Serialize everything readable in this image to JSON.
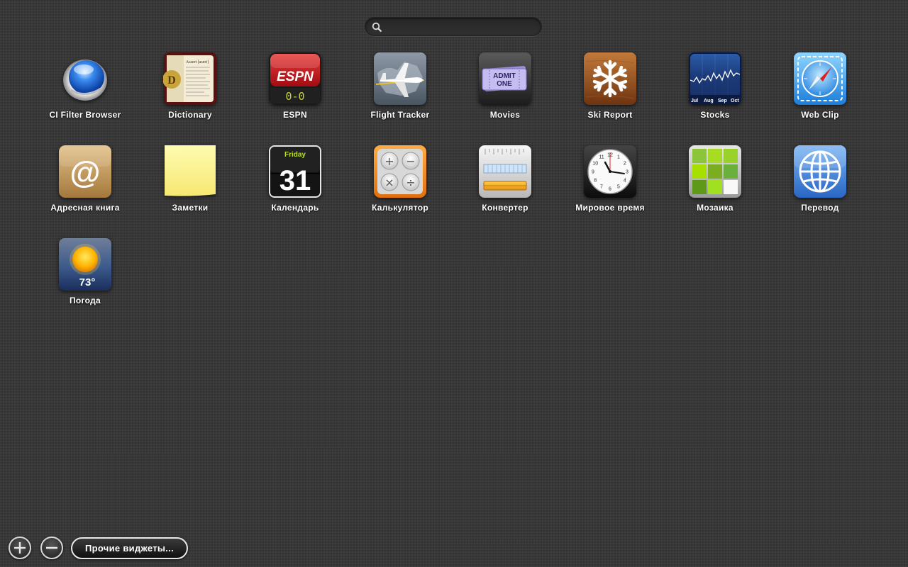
{
  "search": {
    "placeholder": "",
    "value": ""
  },
  "widgets": [
    {
      "label": "CI Filter Browser",
      "icon": "ci-filter-icon"
    },
    {
      "label": "Dictionary",
      "icon": "dictionary-icon",
      "card_text": "Assert [asert]"
    },
    {
      "label": "ESPN",
      "icon": "espn-icon",
      "brand": "ESPN",
      "score": "0-0"
    },
    {
      "label": "Flight Tracker",
      "icon": "airplane-icon"
    },
    {
      "label": "Movies",
      "icon": "ticket-icon",
      "ticket_line1": "ADMIT",
      "ticket_line2": "ONE"
    },
    {
      "label": "Ski Report",
      "icon": "snowflake-icon"
    },
    {
      "label": "Stocks",
      "icon": "stock-chart-icon",
      "months": [
        "Jul",
        "Aug",
        "Sep",
        "Oct"
      ]
    },
    {
      "label": "Web Clip",
      "icon": "compass-icon"
    },
    {
      "label": "Адресная книга",
      "icon": "at-sign-icon",
      "glyph": "@"
    },
    {
      "label": "Заметки",
      "icon": "sticky-note-icon"
    },
    {
      "label": "Календарь",
      "icon": "calendar-icon",
      "day_name": "Friday",
      "day_number": "31"
    },
    {
      "label": "Калькулятор",
      "icon": "calculator-icon",
      "keys": [
        "+",
        "−",
        "×",
        "÷"
      ]
    },
    {
      "label": "Конвертер",
      "icon": "converter-icon"
    },
    {
      "label": "Мировое время",
      "icon": "clock-icon",
      "numerals": [
        "12",
        "1",
        "2",
        "3",
        "4",
        "5",
        "6",
        "7",
        "8",
        "9",
        "10",
        "11"
      ]
    },
    {
      "label": "Мозаика",
      "icon": "tile-game-icon"
    },
    {
      "label": "Перевод",
      "icon": "globe-icon"
    },
    {
      "label": "Погода",
      "icon": "weather-sun-icon",
      "temperature": "73°"
    }
  ],
  "bottom": {
    "more_widgets_label": "Прочие виджеты..."
  },
  "colors": {
    "background": "#363636",
    "espn_red": "#c8141a",
    "calc_orange": "#f28a1c",
    "stocks_blue": "#1b3a7a",
    "ski_wood": "#8a4a1c",
    "note_yellow": "#fdf48e"
  }
}
